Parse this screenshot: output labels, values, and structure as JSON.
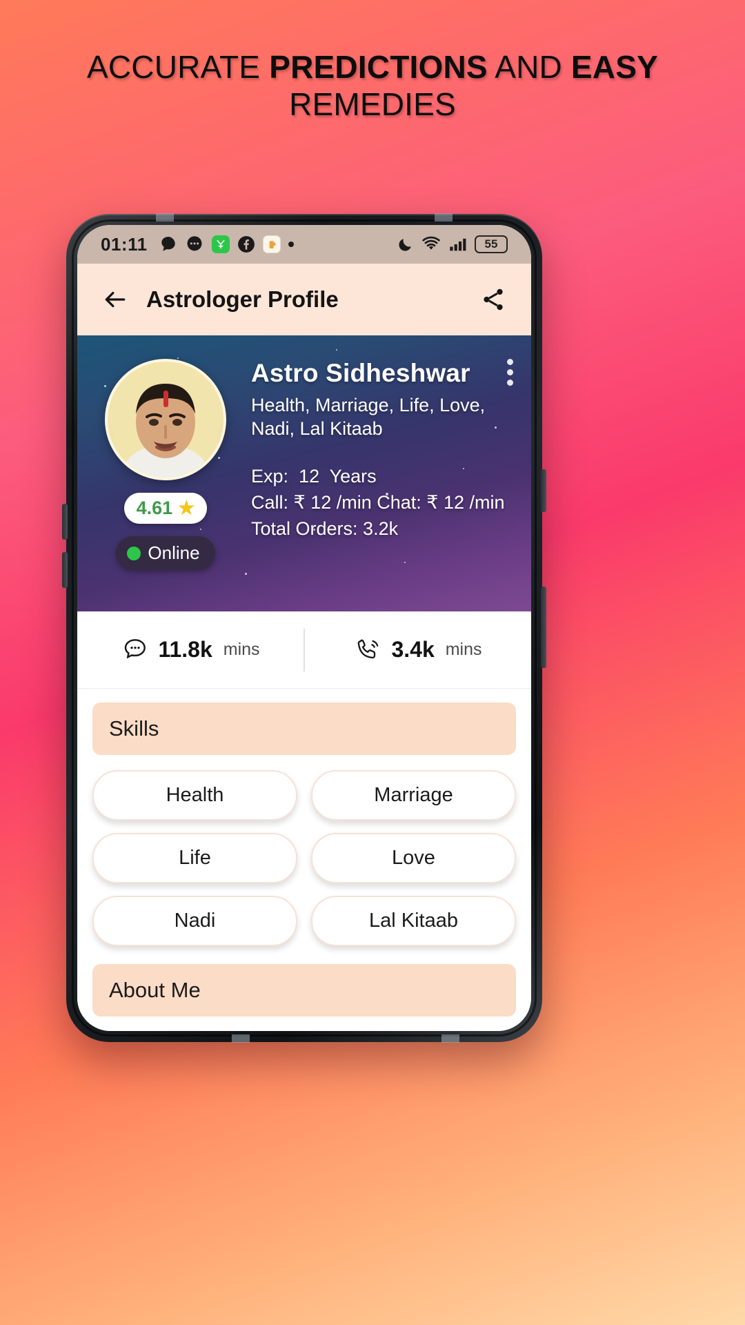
{
  "promo": {
    "line1_part1": "ACCURATE ",
    "line1_bold1": "PREDICTIONS",
    "line1_part2": " AND ",
    "line1_bold2": "EASY",
    "line2": "REMEDIES"
  },
  "status_bar": {
    "time": "01:11",
    "battery_level": "55",
    "left_icons": [
      "chat-bubble-icon",
      "messages-icon",
      "green-app-icon",
      "facebook-icon",
      "beer-app-icon",
      "more-dot-icon"
    ],
    "right_icons": [
      "do-not-disturb-moon-icon",
      "wifi-icon",
      "cellular-signal-icon",
      "battery-icon"
    ]
  },
  "app_bar": {
    "title": "Astrologer Profile",
    "back_icon": "back-arrow-icon",
    "share_icon": "share-icon"
  },
  "profile": {
    "name": "Astro Sidheshwar",
    "tags": "Health, Marriage, Life, Love, Nadi, Lal Kitaab",
    "experience_label": "Exp:",
    "experience_value": "12",
    "experience_unit": "Years",
    "call_line": "Call: ₹ 12 /min Chat: ₹ 12 /min",
    "total_orders": "Total Orders: 3.2k",
    "rating": "4.61",
    "rating_icon": "star-icon",
    "status": "Online",
    "menu_icon": "kebab-menu-icon"
  },
  "stats": {
    "chat": {
      "icon": "chat-bubble-icon",
      "value": "11.8k",
      "unit": "mins"
    },
    "call": {
      "icon": "phone-call-icon",
      "value": "3.4k",
      "unit": "mins"
    }
  },
  "skills": {
    "heading": "Skills",
    "items": [
      "Health",
      "Marriage",
      "Life",
      "Love",
      "Nadi",
      "Lal Kitaab"
    ]
  },
  "about": {
    "heading": "About Me"
  },
  "colors": {
    "accent_peach": "#fbdcc7",
    "appbar_bg": "#fde6d7",
    "online_green": "#2ec64a",
    "rating_green": "#3f9b4a",
    "star_yellow": "#f5c518"
  }
}
